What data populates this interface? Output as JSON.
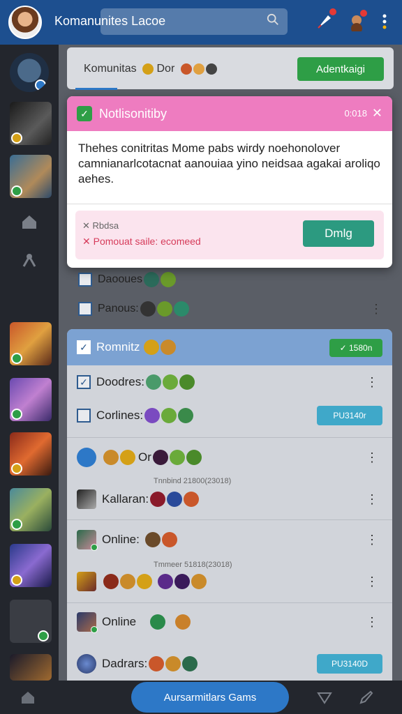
{
  "topbar": {
    "title": "Komanunites Lacoe",
    "search_placeholder": "",
    "icons": [
      "avatar",
      "rocket-icon",
      "profile-icon",
      "more-icon"
    ]
  },
  "main": {
    "community_label": "Komunitas",
    "community_suffix": "Dor",
    "community_button": "Adentkaigi",
    "rows_above": [
      {
        "label": "Daooues"
      },
      {
        "label": "Panous:"
      }
    ]
  },
  "popup": {
    "title": "Notlisonitiby",
    "time": "0:018",
    "body": "Thehes conitritas Mome pabs wirdy noehonolover camnianarlcotacnat aanouiaa yino neidsaa agakai aroliqo aehes.",
    "alert_line1": "Rbdsa",
    "alert_line2": "Pomouat saile: ecomeed",
    "button": "Dmlg"
  },
  "card": {
    "header_label": "Romnitz",
    "header_pill": "✓ 1580n",
    "rows": [
      {
        "label": "Doodres:",
        "kind": "check"
      },
      {
        "label": "Corlines:",
        "kind": "check",
        "pill": "PU3140r"
      },
      {
        "label": "Or",
        "kind": "icon"
      },
      {
        "label": "Kallaran:",
        "kind": "avatar",
        "timestamp": "Tnnbind 21800(23018)"
      },
      {
        "label": "Online:",
        "kind": "avatar"
      },
      {
        "label": "",
        "kind": "avatar",
        "timestamp": "Tmmeer 51818(23018)"
      },
      {
        "label": "Online",
        "kind": "avatar"
      },
      {
        "label": "Dadrars:",
        "kind": "avatar",
        "pill": "PU3140D"
      }
    ]
  },
  "bottombar": {
    "cta": "Aursarmitlars Gams"
  },
  "colors": {
    "topbar": "#1d4f8f",
    "popup_header": "#ee7cc0",
    "card_header": "#7ca2d2",
    "accent_green": "#2e9e46",
    "accent_teal": "#2c9a80",
    "accent_blue": "#2d78c7"
  }
}
